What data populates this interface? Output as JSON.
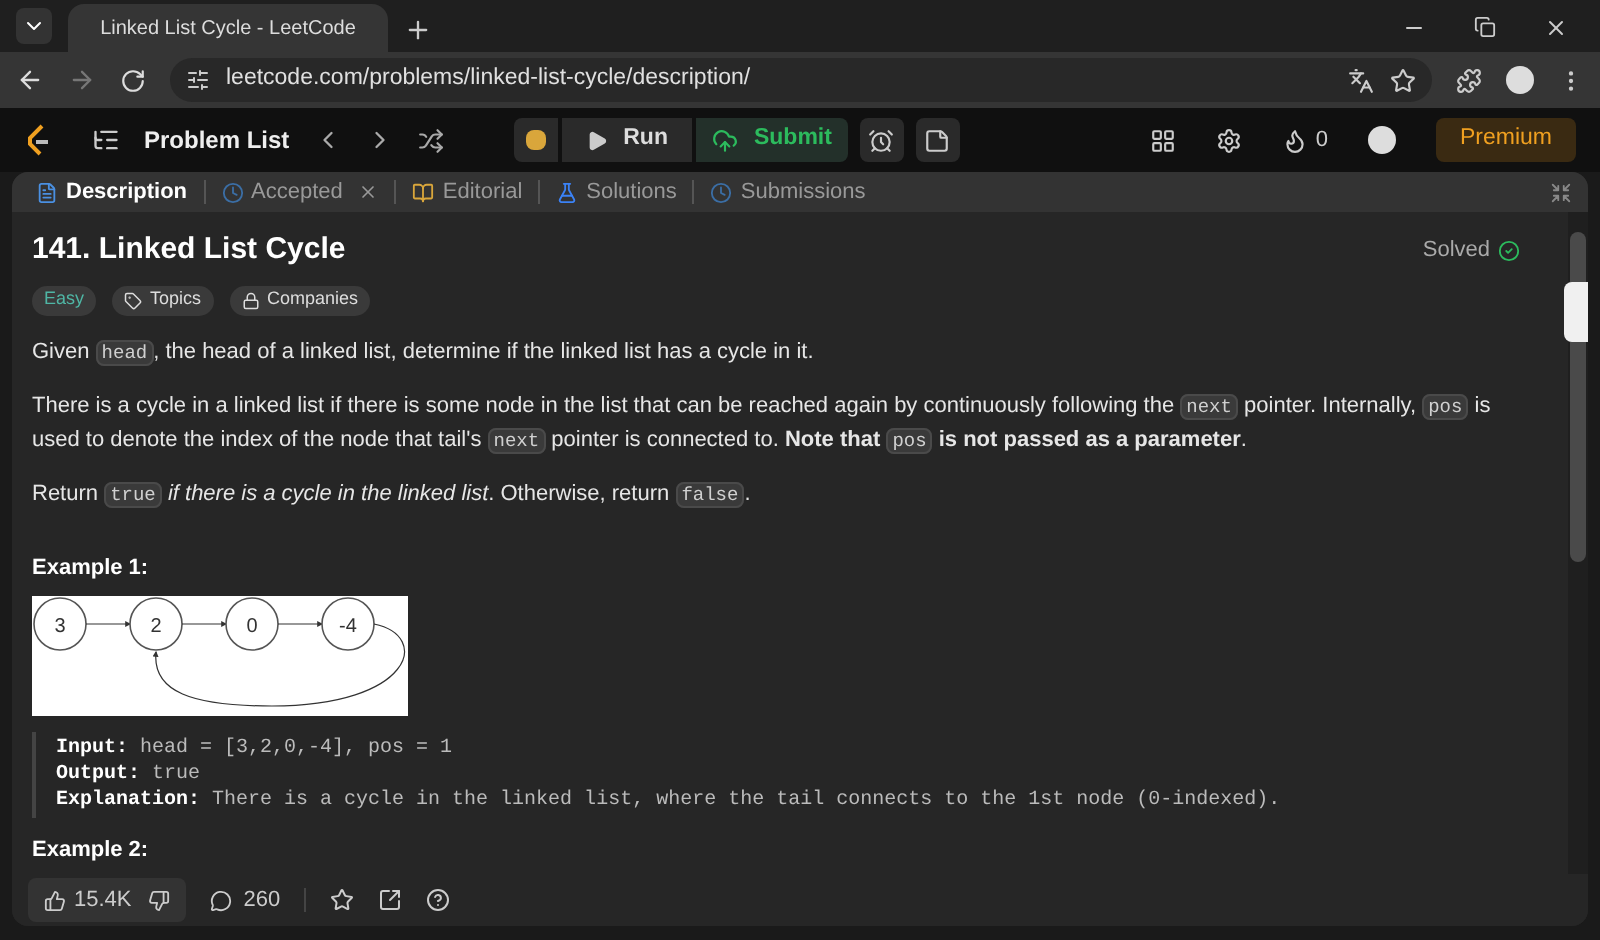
{
  "browser": {
    "tab_title": "Linked List Cycle - LeetCode",
    "url": "leetcode.com/problems/linked-list-cycle/description/"
  },
  "navbar": {
    "problem_list": "Problem List",
    "run": "Run",
    "submit": "Submit",
    "streak": "0",
    "premium": "Premium"
  },
  "panel_tabs": [
    {
      "label": "Description",
      "selected": true,
      "closable": false
    },
    {
      "label": "Accepted",
      "selected": false,
      "closable": true
    },
    {
      "label": "Editorial",
      "selected": false,
      "closable": false
    },
    {
      "label": "Solutions",
      "selected": false,
      "closable": false
    },
    {
      "label": "Submissions",
      "selected": false,
      "closable": false
    }
  ],
  "problem": {
    "title": "141. Linked List Cycle",
    "status": "Solved",
    "difficulty": "Easy",
    "tags": [
      "Topics",
      "Companies"
    ],
    "paragraphs": [
      [
        {
          "kind": "text",
          "text": "Given "
        },
        {
          "kind": "code",
          "text": "head"
        },
        {
          "kind": "text",
          "text": ", the head of a linked list, determine if the linked list has a cycle in it."
        }
      ],
      [
        {
          "kind": "text",
          "text": "There is a cycle in a linked list if there is some node in the list that can be reached again by continuously following the "
        },
        {
          "kind": "code",
          "text": "next"
        },
        {
          "kind": "text",
          "text": " pointer. Internally, "
        },
        {
          "kind": "code",
          "text": "pos"
        },
        {
          "kind": "text",
          "text": " is used to denote the index of the node that tail's "
        },
        {
          "kind": "code",
          "text": "next"
        },
        {
          "kind": "text",
          "text": " pointer is connected to. **Note that** "
        },
        {
          "kind": "code",
          "text": "pos"
        },
        {
          "kind": "text",
          "text": " **is not passed as a parameter**."
        }
      ],
      [
        {
          "kind": "text",
          "text": "Return "
        },
        {
          "kind": "code",
          "text": "true"
        },
        {
          "kind": "text",
          "text": " *if there is a cycle in the linked list*. Otherwise, return "
        },
        {
          "kind": "code",
          "text": "false"
        },
        {
          "kind": "text",
          "text": "."
        }
      ]
    ],
    "examples": [
      {
        "heading": "Example 1:",
        "nodes": [
          "3",
          "2",
          "0",
          "-4"
        ],
        "lines": [
          {
            "label": "Input:",
            "value": "head = [3,2,0,-4], pos = 1"
          },
          {
            "label": "Output:",
            "value": "true"
          },
          {
            "label": "Explanation:",
            "value": "There is a cycle in the linked list, where the tail connects to the 1st node (0-indexed)."
          }
        ]
      },
      {
        "heading": "Example 2:"
      }
    ]
  },
  "footer": {
    "likes": "15.4K",
    "comments": "260"
  }
}
